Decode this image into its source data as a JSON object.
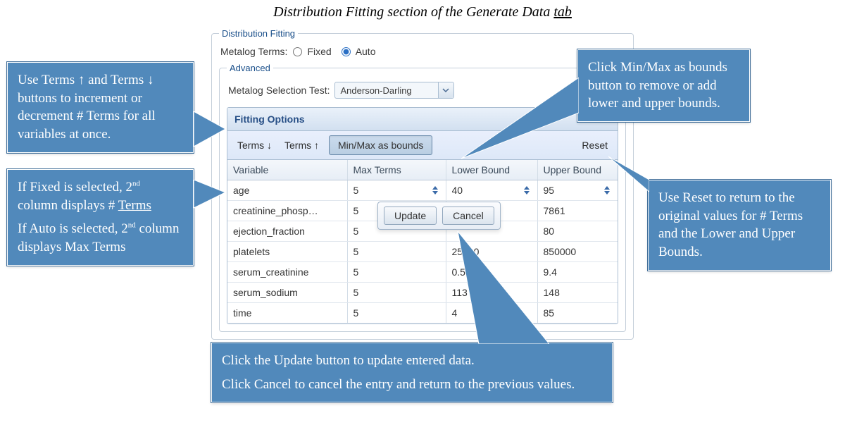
{
  "caption": {
    "text": "Distribution Fitting section of the Generate Data ",
    "tab_word": "tab"
  },
  "panel": {
    "legend": "Distribution Fitting",
    "metalog_label": "Metalog Terms:",
    "radio_fixed": "Fixed",
    "radio_auto": "Auto",
    "selected_mode": "auto",
    "advanced_legend": "Advanced",
    "selection_test_label": "Metalog Selection Test:",
    "selection_test_value": "Anderson-Darling",
    "fitting_options_title": "Fitting Options",
    "toolbar": {
      "terms_down": "Terms ↓",
      "terms_up": "Terms ↑",
      "minmax_btn": "Min/Max as bounds",
      "reset": "Reset"
    },
    "columns": {
      "variable": "Variable",
      "max_terms": "Max Terms",
      "lower": "Lower Bound",
      "upper": "Upper Bound"
    },
    "rows": [
      {
        "variable": "age",
        "max_terms": "5",
        "lower": "40",
        "upper": "95",
        "editing": true
      },
      {
        "variable": "creatinine_phosp…",
        "max_terms": "5",
        "lower": "",
        "upper": "7861"
      },
      {
        "variable": "ejection_fraction",
        "max_terms": "5",
        "lower": "",
        "upper": "80"
      },
      {
        "variable": "platelets",
        "max_terms": "5",
        "lower": "25100",
        "upper": "850000"
      },
      {
        "variable": "serum_creatinine",
        "max_terms": "5",
        "lower": "0.5",
        "upper": "9.4"
      },
      {
        "variable": "serum_sodium",
        "max_terms": "5",
        "lower": "113",
        "upper": "148"
      },
      {
        "variable": "time",
        "max_terms": "5",
        "lower": "4",
        "upper": "85"
      }
    ]
  },
  "popup": {
    "update": "Update",
    "cancel": "Cancel"
  },
  "callouts": {
    "terms": "Use Terms ↑ and Terms ↓ buttons to increment or decrement # Terms for all variables at once.",
    "col2_p1_a": "If Fixed is selected, 2",
    "col2_p1_b": " column displays # ",
    "col2_p1_terms": "Terms",
    "col2_p2_a": "If Auto is selected, 2",
    "col2_p2_b": " column displays Max Terms",
    "minmax": "Click Min/Max as bounds button to remove or add lower and upper bounds.",
    "reset": "Use Reset to return to the original values for # Terms and the Lower and Upper Bounds.",
    "update_p1": "Click the Update button to update entered data.",
    "update_p2": "Click Cancel to cancel the entry and return to the previous values."
  }
}
